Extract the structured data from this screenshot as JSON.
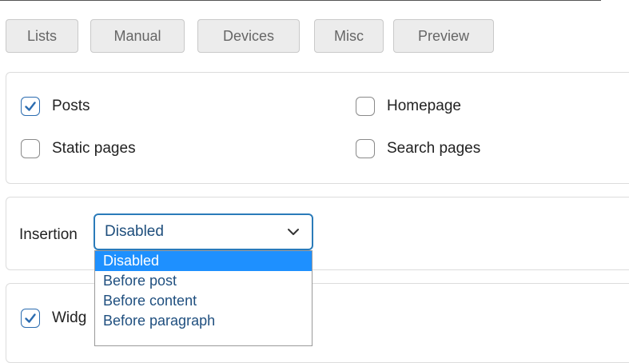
{
  "tabs": [
    "Lists",
    "Manual",
    "Devices",
    "Misc",
    "Preview"
  ],
  "display": {
    "posts": {
      "label": "Posts",
      "checked": true
    },
    "homepage": {
      "label": "Homepage",
      "checked": false
    },
    "static_pages": {
      "label": "Static pages",
      "checked": false
    },
    "search_pages": {
      "label": "Search pages",
      "checked": false
    }
  },
  "insertion": {
    "label": "Insertion",
    "selected": "Disabled",
    "options": [
      "Disabled",
      "Before post",
      "Before content",
      "Before paragraph"
    ]
  },
  "widget": {
    "label": "Widg",
    "checked": true
  },
  "colors": {
    "accent": "#2b7bb9",
    "highlight": "#1e90ff"
  }
}
